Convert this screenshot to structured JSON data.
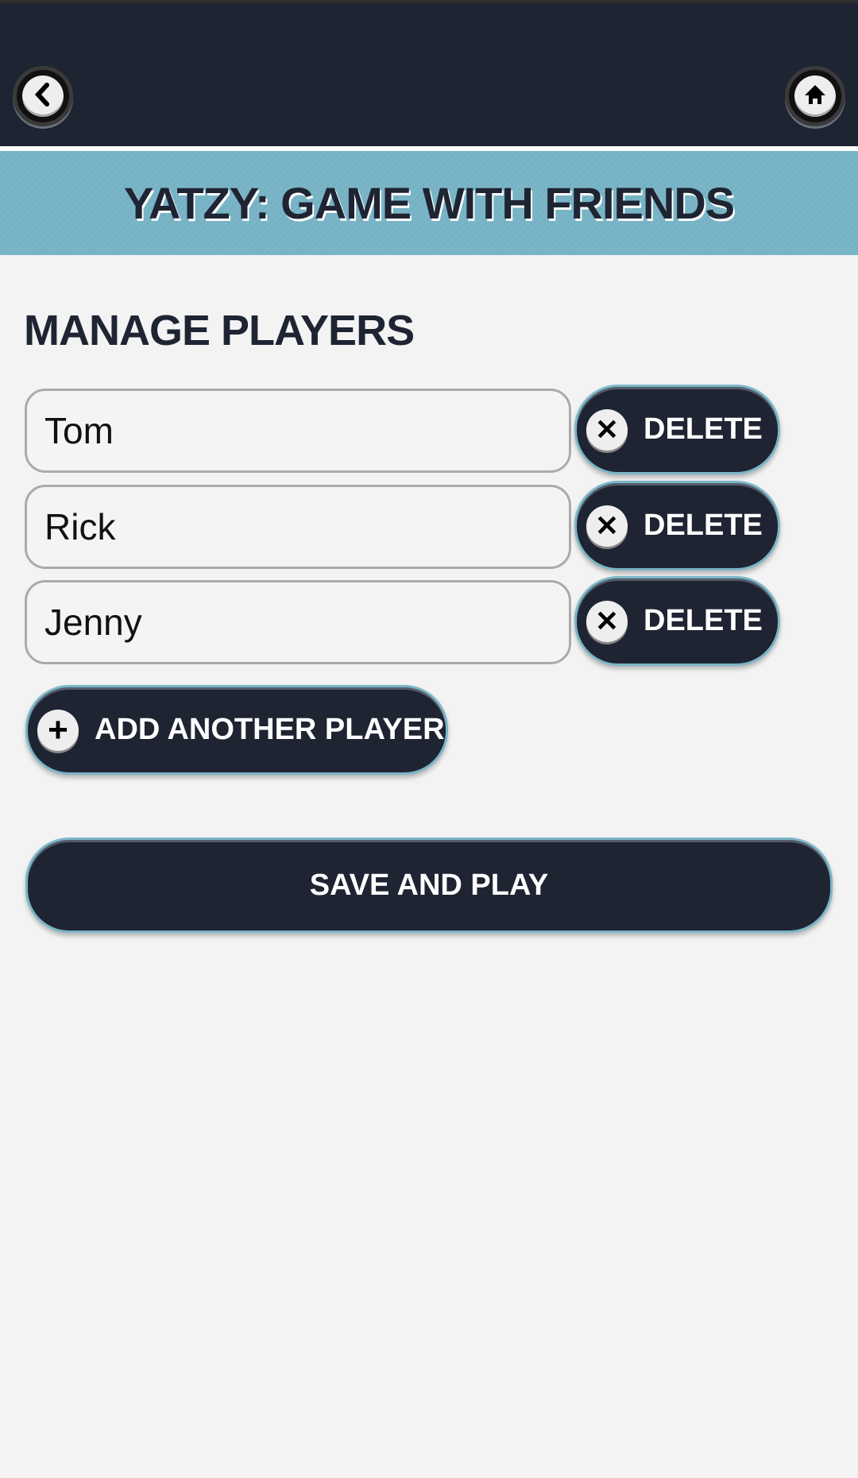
{
  "header": {
    "back_icon": "chevron-left-icon",
    "home_icon": "home-icon",
    "title": "YATZY: GAME WITH FRIENDS"
  },
  "main": {
    "heading": "MANAGE PLAYERS",
    "players": [
      {
        "name": "Tom",
        "delete_label": "DELETE"
      },
      {
        "name": "Rick",
        "delete_label": "DELETE"
      },
      {
        "name": "Jenny",
        "delete_label": "DELETE"
      }
    ],
    "add_label": "ADD ANOTHER PLAYER",
    "save_label": "SAVE AND PLAY"
  },
  "colors": {
    "dark": "#1f2433",
    "accent": "#7ab6c7",
    "background": "#f3f3f3"
  }
}
